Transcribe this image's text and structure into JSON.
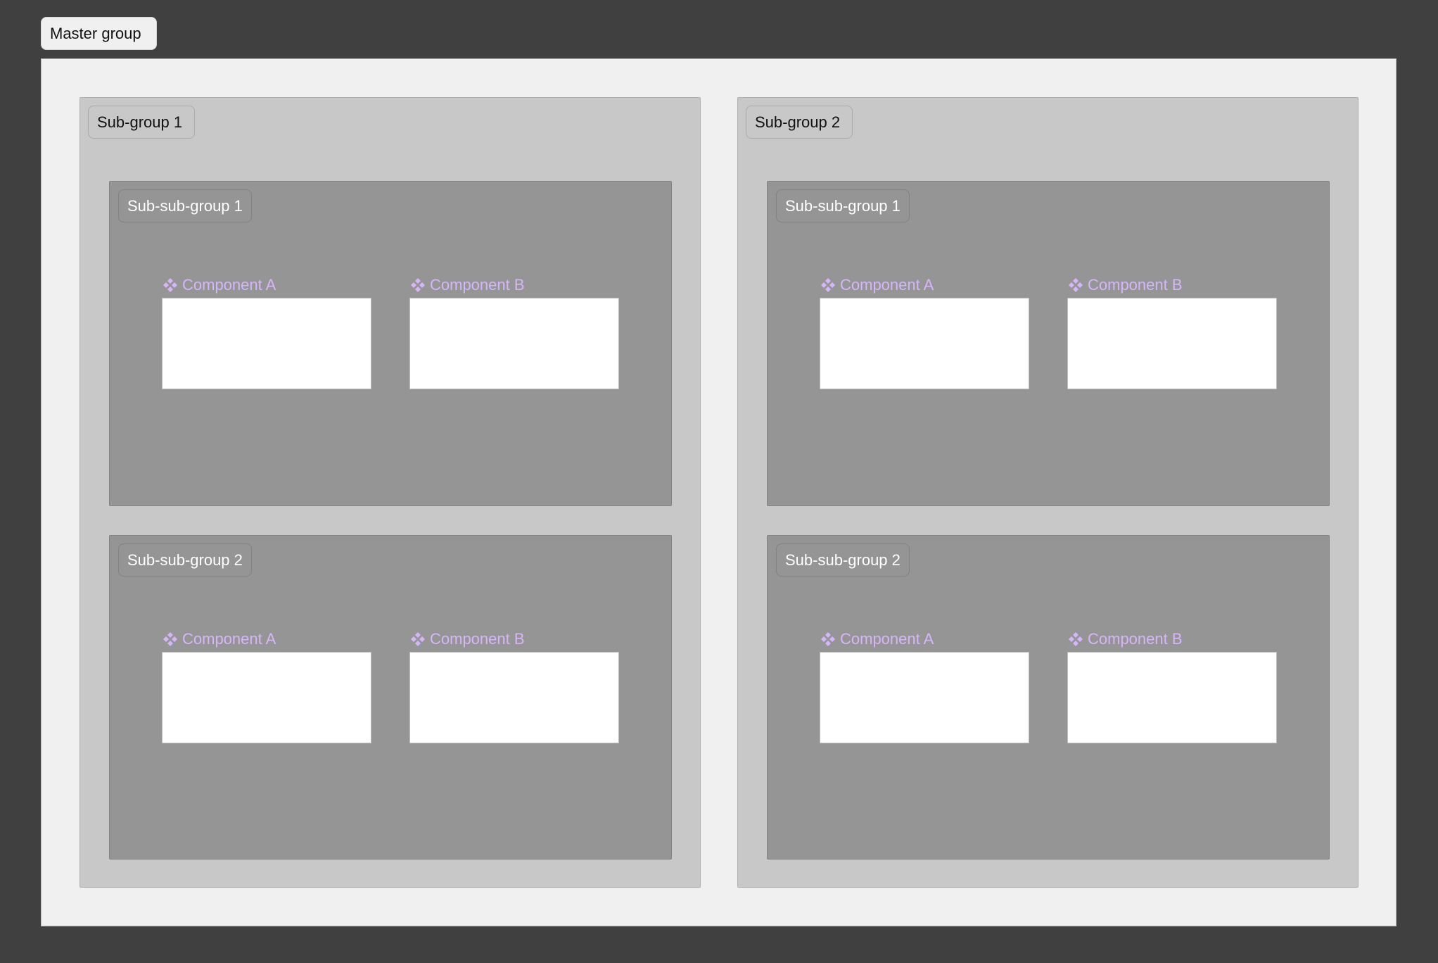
{
  "master": {
    "label": "Master group",
    "subgroups": [
      {
        "label": "Sub-group 1",
        "subsubgroups": [
          {
            "label": "Sub-sub-group 1",
            "components": [
              {
                "label": "Component A",
                "icon": "component-icon"
              },
              {
                "label": "Component B",
                "icon": "component-icon"
              }
            ]
          },
          {
            "label": "Sub-sub-group 2",
            "components": [
              {
                "label": "Component A",
                "icon": "component-icon"
              },
              {
                "label": "Component B",
                "icon": "component-icon"
              }
            ]
          }
        ]
      },
      {
        "label": "Sub-group 2",
        "subsubgroups": [
          {
            "label": "Sub-sub-group 1",
            "components": [
              {
                "label": "Component A",
                "icon": "component-icon"
              },
              {
                "label": "Component B",
                "icon": "component-icon"
              }
            ]
          },
          {
            "label": "Sub-sub-group 2",
            "components": [
              {
                "label": "Component A",
                "icon": "component-icon"
              },
              {
                "label": "Component B",
                "icon": "component-icon"
              }
            ]
          }
        ]
      }
    ]
  },
  "colors": {
    "canvas_background": "#404040",
    "master_fill": "#f0f0f0",
    "subgroup_fill": "#c8c8c8",
    "subsubgroup_fill": "#959595",
    "component_fill": "#ffffff",
    "component_label": "#d6b6f8"
  }
}
